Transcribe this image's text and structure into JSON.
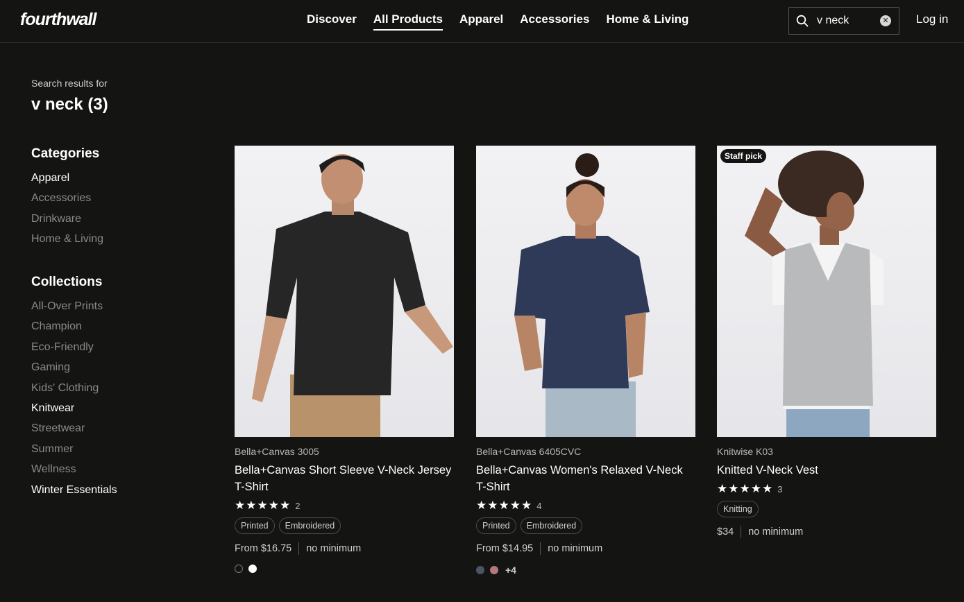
{
  "header": {
    "logo": "fourthwall",
    "nav": [
      {
        "label": "Discover",
        "active": false
      },
      {
        "label": "All Products",
        "active": true
      },
      {
        "label": "Apparel",
        "active": false
      },
      {
        "label": "Accessories",
        "active": false
      },
      {
        "label": "Home & Living",
        "active": false
      }
    ],
    "search_value": "v neck",
    "login_label": "Log in"
  },
  "sidebar": {
    "results_label": "Search results for",
    "results_query": "v neck (3)",
    "categories_heading": "Categories",
    "categories": [
      "Apparel",
      "Accessories",
      "Drinkware",
      "Home & Living"
    ],
    "collections_heading": "Collections",
    "collections": [
      "All-Over Prints",
      "Champion",
      "Eco-Friendly",
      "Gaming",
      "Kids' Clothing",
      "Knitwear",
      "Streetwear",
      "Summer",
      "Wellness",
      "Winter Essentials"
    ]
  },
  "products": [
    {
      "brand": "Bella+Canvas 3005",
      "title": "Bella+Canvas Short Sleeve V-Neck Jersey T-Shirt",
      "stars": "★★★★★",
      "rating_count": "2",
      "tags": [
        "Printed",
        "Embroidered"
      ],
      "price": "From $16.75",
      "minimum": "no minimum",
      "swatch_colors": [
        "#141412",
        "#ffffff"
      ],
      "more_colors": ""
    },
    {
      "brand": "Bella+Canvas 6405CVC",
      "title": "Bella+Canvas Women's Relaxed V-Neck T-Shirt",
      "stars": "★★★★★",
      "rating_count": "4",
      "tags": [
        "Printed",
        "Embroidered"
      ],
      "price": "From $14.95",
      "minimum": "no minimum",
      "swatch_colors": [
        "#4a5566",
        "#b07a7a"
      ],
      "more_colors": "+4"
    },
    {
      "badge": "Staff pick",
      "brand": "Knitwise K03",
      "title": "Knitted V-Neck Vest",
      "stars": "★★★★★",
      "rating_count": "3",
      "tags": [
        "Knitting"
      ],
      "price": "$34",
      "minimum": "no minimum"
    }
  ],
  "icons": {
    "search": "search-icon",
    "clear": "clear-search-icon",
    "star": "star-icon"
  },
  "colors": {
    "background": "#141412",
    "text": "#ffffff",
    "muted_text": "#8a8a85"
  }
}
